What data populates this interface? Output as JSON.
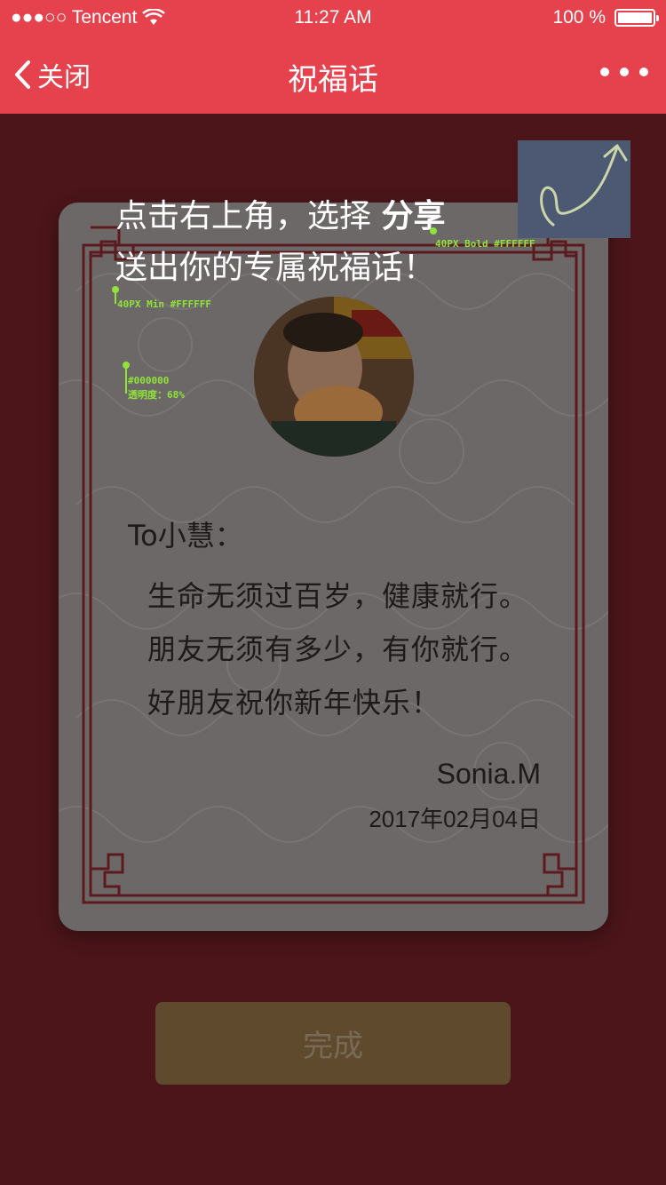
{
  "status_bar": {
    "carrier": "●●●○○ Tencent",
    "time": "11:27 AM",
    "battery": "100 %"
  },
  "nav": {
    "back_label": "关闭",
    "title": "祝福话"
  },
  "hint": {
    "line1_prefix": "点击右上角，选择 ",
    "line1_emphasis": "分享",
    "line2": "送出你的专属祝福话！"
  },
  "annotations": {
    "bold_note": "40PX Bold #FFFFFF",
    "min_note": "40PX Min #FFFFFF",
    "overlay_color": "#000000",
    "overlay_opacity": "透明度：68%"
  },
  "card": {
    "to": "To小慧：",
    "lines": [
      "生命无须过百岁，健康就行。",
      "朋友无须有多少，有你就行。",
      "好朋友祝你新年快乐！"
    ],
    "signature": "Sonia.M",
    "date": "2017年02月04日"
  },
  "done_button": "完成",
  "colors": {
    "brand": "#e6424d",
    "annotation": "#8fe33a",
    "background": "#4b1519"
  }
}
